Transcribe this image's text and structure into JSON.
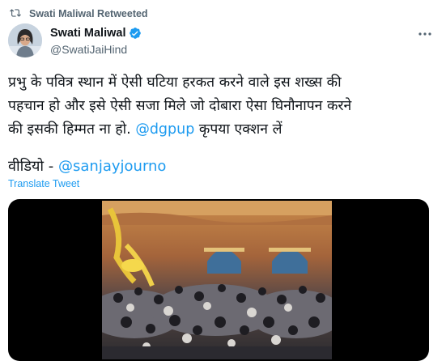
{
  "retweet": {
    "label": "Swati Maliwal Retweeted",
    "icon": "retweet-icon"
  },
  "author": {
    "name": "Swati Maliwal",
    "handle": "@SwatiJaiHind",
    "verified": true
  },
  "tweet": {
    "line1": "प्रभु के पवित्र स्थान में ऐसी घटिया हरकत करने वाले इस शख्स की",
    "line2": "पहचान हो और इसे ऐसी सजा मिले जो दोबारा ऐसा घिनौनापन करने",
    "line3_before": "की इसकी हिम्मत ना हो. ",
    "mention": "@dgpup",
    "line3_after": " कृपया एक्शन लें",
    "video_prefix": "वीडियो - ",
    "video_mention": "@sanjayjourno",
    "translate": "Translate Tweet"
  },
  "colors": {
    "link": "#1d9bf0",
    "secondary": "#536471",
    "text": "#0f1419"
  }
}
